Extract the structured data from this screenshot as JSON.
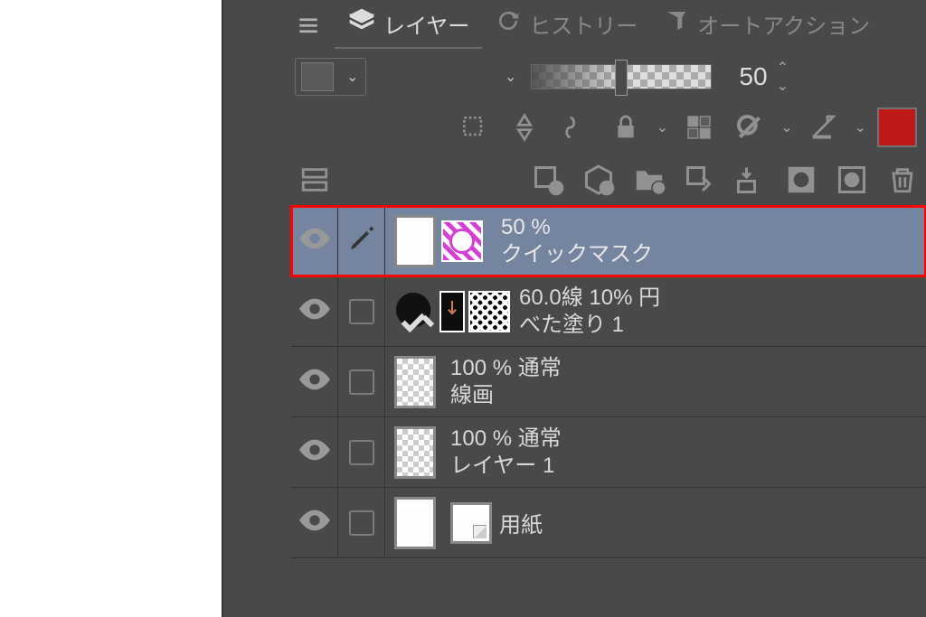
{
  "tabs": {
    "layers": "レイヤー",
    "history": "ヒストリー",
    "autoAction": "オートアクション"
  },
  "opacity": {
    "value": "50"
  },
  "layers_list": {
    "l0": {
      "top": "50 %",
      "name": "クイックマスク"
    },
    "l1": {
      "top": "60.0線 10% 円",
      "name": "べた塗り 1"
    },
    "l2": {
      "top": "100 % 通常",
      "name": "線画"
    },
    "l3": {
      "top": "100 % 通常",
      "name": "レイヤー 1"
    },
    "l4": {
      "name": "用紙"
    }
  }
}
